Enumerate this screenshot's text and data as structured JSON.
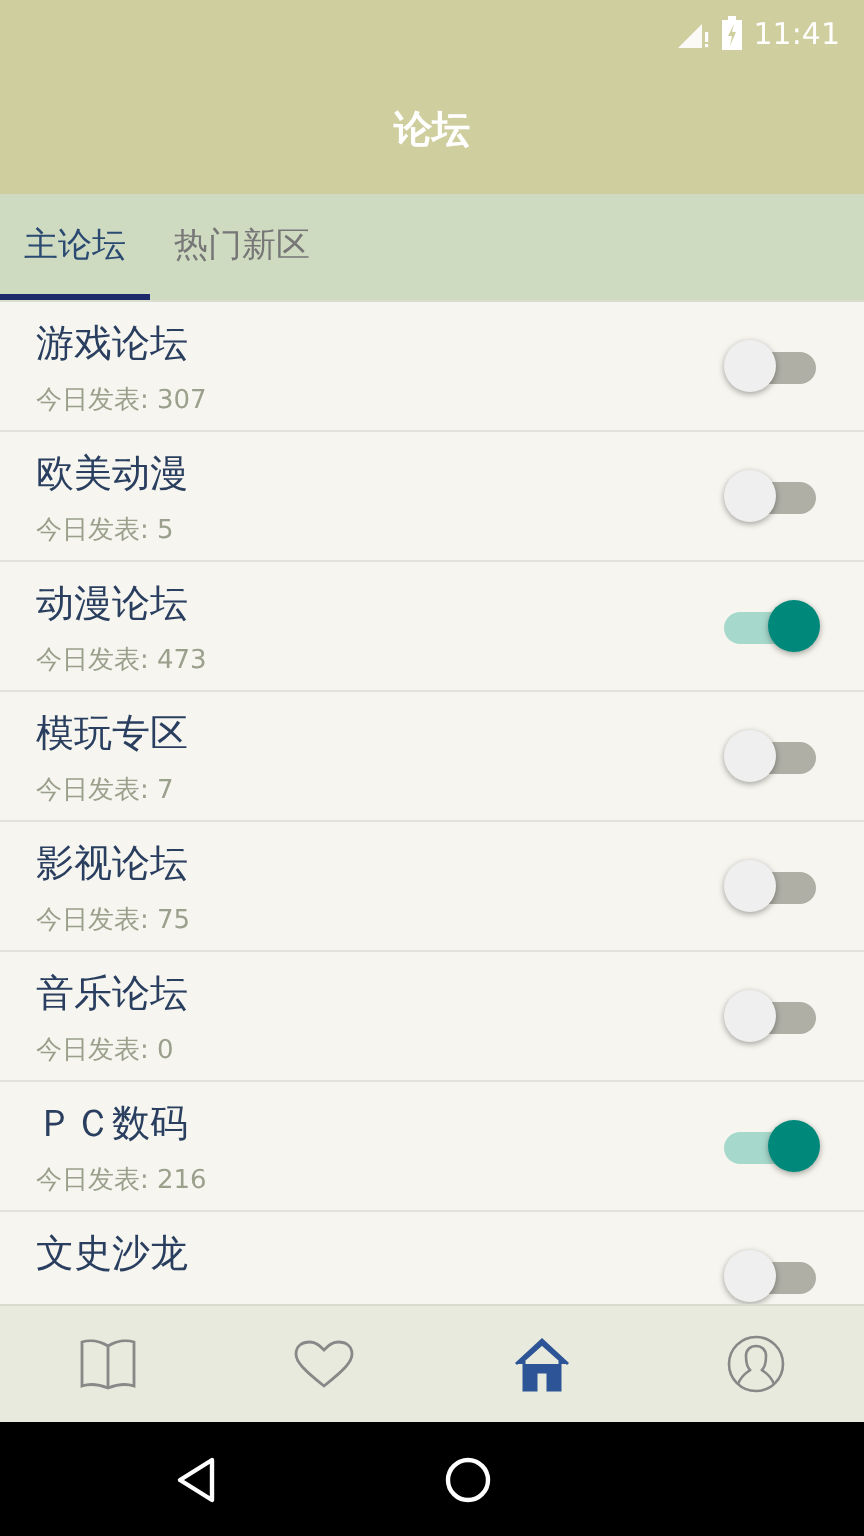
{
  "status_bar": {
    "time": "11:41"
  },
  "header": {
    "title": "论坛"
  },
  "tabs": [
    {
      "label": "主论坛",
      "selected": true
    },
    {
      "label": "热门新区",
      "selected": false
    }
  ],
  "forums": [
    {
      "name": "游戏论坛",
      "posts": "今日发表: 307",
      "on": false
    },
    {
      "name": "欧美动漫",
      "posts": "今日发表: 5",
      "on": false
    },
    {
      "name": "动漫论坛",
      "posts": "今日发表: 473",
      "on": true
    },
    {
      "name": "模玩专区",
      "posts": "今日发表: 7",
      "on": false
    },
    {
      "name": "影视论坛",
      "posts": "今日发表: 75",
      "on": false
    },
    {
      "name": "音乐论坛",
      "posts": "今日发表: 0",
      "on": false
    },
    {
      "name": "ＰＣ数码",
      "posts": "今日发表: 216",
      "on": true
    },
    {
      "name": "文史沙龙",
      "on": false
    }
  ],
  "bottom_nav": [
    {
      "kind": "book",
      "selected": false
    },
    {
      "kind": "heart",
      "selected": false
    },
    {
      "kind": "home",
      "selected": true
    },
    {
      "kind": "profile",
      "selected": false
    }
  ]
}
